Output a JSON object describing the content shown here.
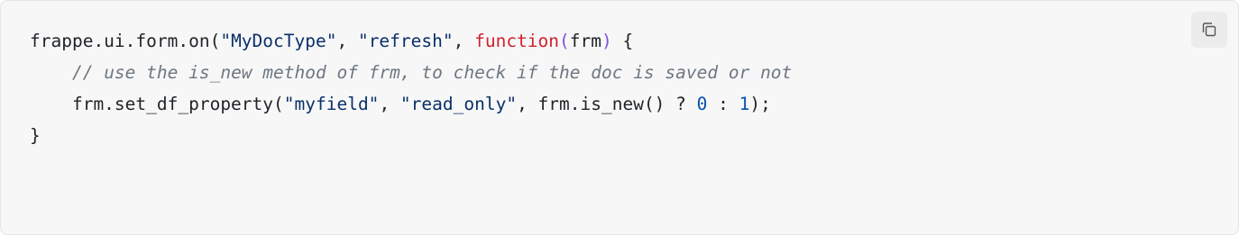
{
  "code_block": {
    "language": "javascript",
    "lines": [
      {
        "tokens": [
          {
            "type": "plain",
            "text": "frappe.ui.form.on("
          },
          {
            "type": "string",
            "text": "\"MyDocType\""
          },
          {
            "type": "plain",
            "text": ", "
          },
          {
            "type": "string",
            "text": "\"refresh\""
          },
          {
            "type": "plain",
            "text": ", "
          },
          {
            "type": "keyword",
            "text": "function"
          },
          {
            "type": "paren-kw",
            "text": "("
          },
          {
            "type": "plain",
            "text": "frm"
          },
          {
            "type": "paren-kw",
            "text": ")"
          },
          {
            "type": "plain",
            "text": " {"
          }
        ]
      },
      {
        "tokens": [
          {
            "type": "plain",
            "text": "    "
          },
          {
            "type": "comment",
            "text": "// use the is_new method of frm, to check if the doc is saved or not"
          }
        ]
      },
      {
        "tokens": [
          {
            "type": "plain",
            "text": "    frm.set_df_property("
          },
          {
            "type": "string",
            "text": "\"myfield\""
          },
          {
            "type": "plain",
            "text": ", "
          },
          {
            "type": "string",
            "text": "\"read_only\""
          },
          {
            "type": "plain",
            "text": ", frm.is_new() ? "
          },
          {
            "type": "number",
            "text": "0"
          },
          {
            "type": "plain",
            "text": " : "
          },
          {
            "type": "number",
            "text": "1"
          },
          {
            "type": "plain",
            "text": ");"
          }
        ]
      },
      {
        "tokens": [
          {
            "type": "plain",
            "text": "}"
          }
        ]
      }
    ]
  },
  "copy_button": {
    "icon": "copy-icon"
  },
  "colors": {
    "background": "#f7f7f7",
    "string": "#0a3069",
    "keyword": "#cf222e",
    "comment": "#6e7781",
    "number": "#0550ae"
  }
}
